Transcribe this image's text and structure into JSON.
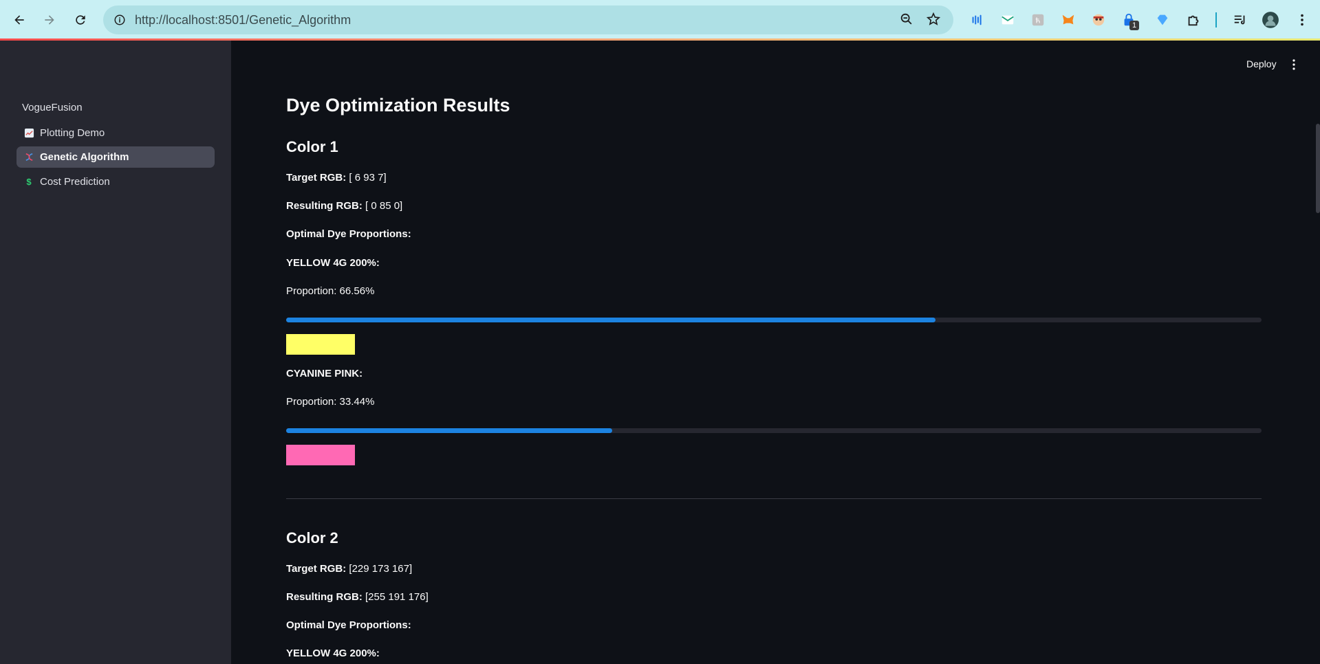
{
  "browser": {
    "url": "http://localhost:8501/Genetic_Algorithm",
    "extension_badge": "1"
  },
  "header": {
    "deploy_label": "Deploy"
  },
  "sidebar": {
    "app_name": "VogueFusion",
    "items": [
      {
        "label": "Plotting Demo",
        "icon": "chart-icon",
        "active": false
      },
      {
        "label": "Genetic Algorithm",
        "icon": "dna-icon",
        "active": true
      },
      {
        "label": "Cost Prediction",
        "icon": "dollar-icon",
        "active": false
      }
    ]
  },
  "main": {
    "title": "Dye Optimization Results",
    "colors": [
      {
        "heading": "Color 1",
        "target_label": "Target RGB:",
        "target_value": " [ 6 93 7]",
        "result_label": "Resulting RGB:",
        "result_value": " [ 0 85 0]",
        "proportions_label": "Optimal Dye Proportions:",
        "dyes": [
          {
            "name": "YELLOW 4G 200%:",
            "proportion_text": "Proportion: 66.56%",
            "proportion": 0.6656,
            "swatch": "#ffff66"
          },
          {
            "name": "CYANINE PINK:",
            "proportion_text": "Proportion: 33.44%",
            "proportion": 0.3344,
            "swatch": "#ff69b4"
          }
        ]
      },
      {
        "heading": "Color 2",
        "target_label": "Target RGB:",
        "target_value": " [229 173 167]",
        "result_label": "Resulting RGB:",
        "result_value": " [255 191 176]",
        "proportions_label": "Optimal Dye Proportions:",
        "dyes": [
          {
            "name": "YELLOW 4G 200%:"
          }
        ]
      }
    ]
  },
  "colors": {
    "progress_fill": "#1c83e1",
    "background": "#0e1117",
    "sidebar_bg": "#262730"
  }
}
